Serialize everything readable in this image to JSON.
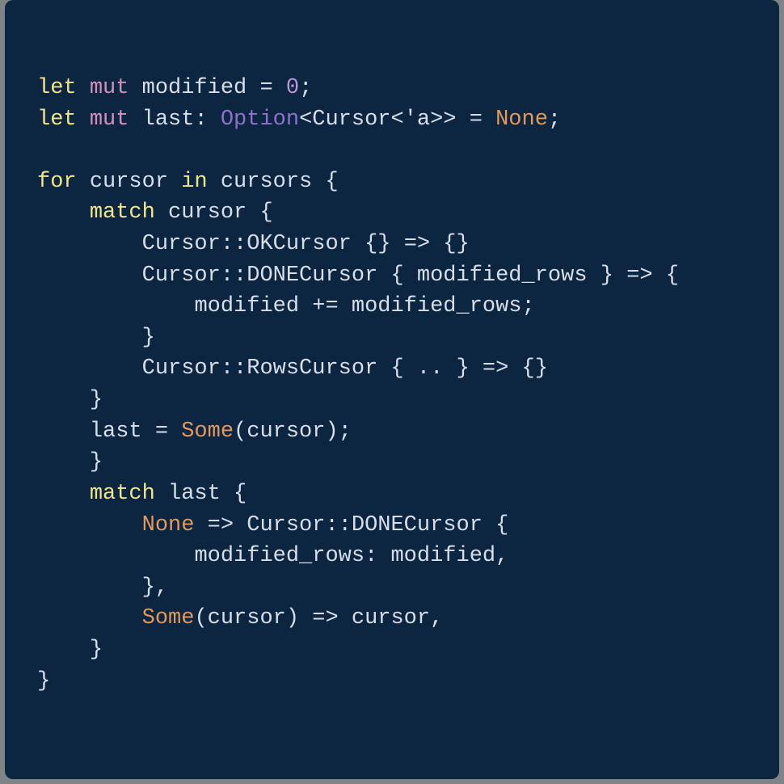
{
  "code": {
    "l0": {
      "let": "let",
      "mut": "mut",
      "modified": "modified",
      "eq": "=",
      "zero": "0",
      "semi": ";"
    },
    "l1": {
      "let": "let",
      "mut": "mut",
      "last": "last",
      "colon": ":",
      "Option": "Option",
      "lt": "<",
      "Cursor": "Cursor",
      "lt2": "<",
      "tick_a": "'a",
      "gt": ">",
      "gt2": ">",
      "eq": "=",
      "None": "None",
      "semi": ";"
    },
    "l3": {
      "for": "for",
      "cursor": "cursor",
      "in": "in",
      "cursors": "cursors",
      "ob": "{"
    },
    "l4": {
      "match": "match",
      "cursor": "cursor",
      "ob": "{"
    },
    "l5": {
      "Cursor": "Cursor",
      "cc": "::",
      "OKCursor": "OKCursor",
      "ob": "{",
      "cb": "}",
      "arrow": "=>",
      "ob2": "{",
      "cb2": "}"
    },
    "l6": {
      "Cursor": "Cursor",
      "cc": "::",
      "DONECursor": "DONECursor",
      "ob": "{",
      "mrows": "modified_rows",
      "cb": "}",
      "arrow": "=>",
      "ob2": "{"
    },
    "l7": {
      "modified": "modified",
      "peq": "+=",
      "mrows": "modified_rows",
      "semi": ";"
    },
    "l8": {
      "cb": "}"
    },
    "l9": {
      "Cursor": "Cursor",
      "cc": "::",
      "RowsCursor": "RowsCursor",
      "ob": "{",
      "dd": "..",
      "cb": "}",
      "arrow": "=>",
      "ob2": "{",
      "cb2": "}"
    },
    "l10": {
      "cb": "}"
    },
    "l11": {
      "last": "last",
      "eq": "=",
      "Some": "Some",
      "lp": "(",
      "cursor": "cursor",
      "rp": ")",
      "semi": ";"
    },
    "l12": {
      "cb": "}"
    },
    "l13": {
      "match": "match",
      "last": "last",
      "ob": "{"
    },
    "l14": {
      "None": "None",
      "arrow": "=>",
      "Cursor": "Cursor",
      "cc": "::",
      "DONECursor": "DONECursor",
      "ob": "{"
    },
    "l15": {
      "mrows": "modified_rows",
      "colon": ":",
      "modified": "modified",
      "comma": ","
    },
    "l16": {
      "cb": "}",
      "comma": ","
    },
    "l17": {
      "Some": "Some",
      "lp": "(",
      "cursor": "cursor",
      "rp": ")",
      "arrow": "=>",
      "cursor2": "cursor",
      "comma": ","
    },
    "l18": {
      "cb": "}"
    },
    "l19": {
      "cb": "}"
    }
  }
}
